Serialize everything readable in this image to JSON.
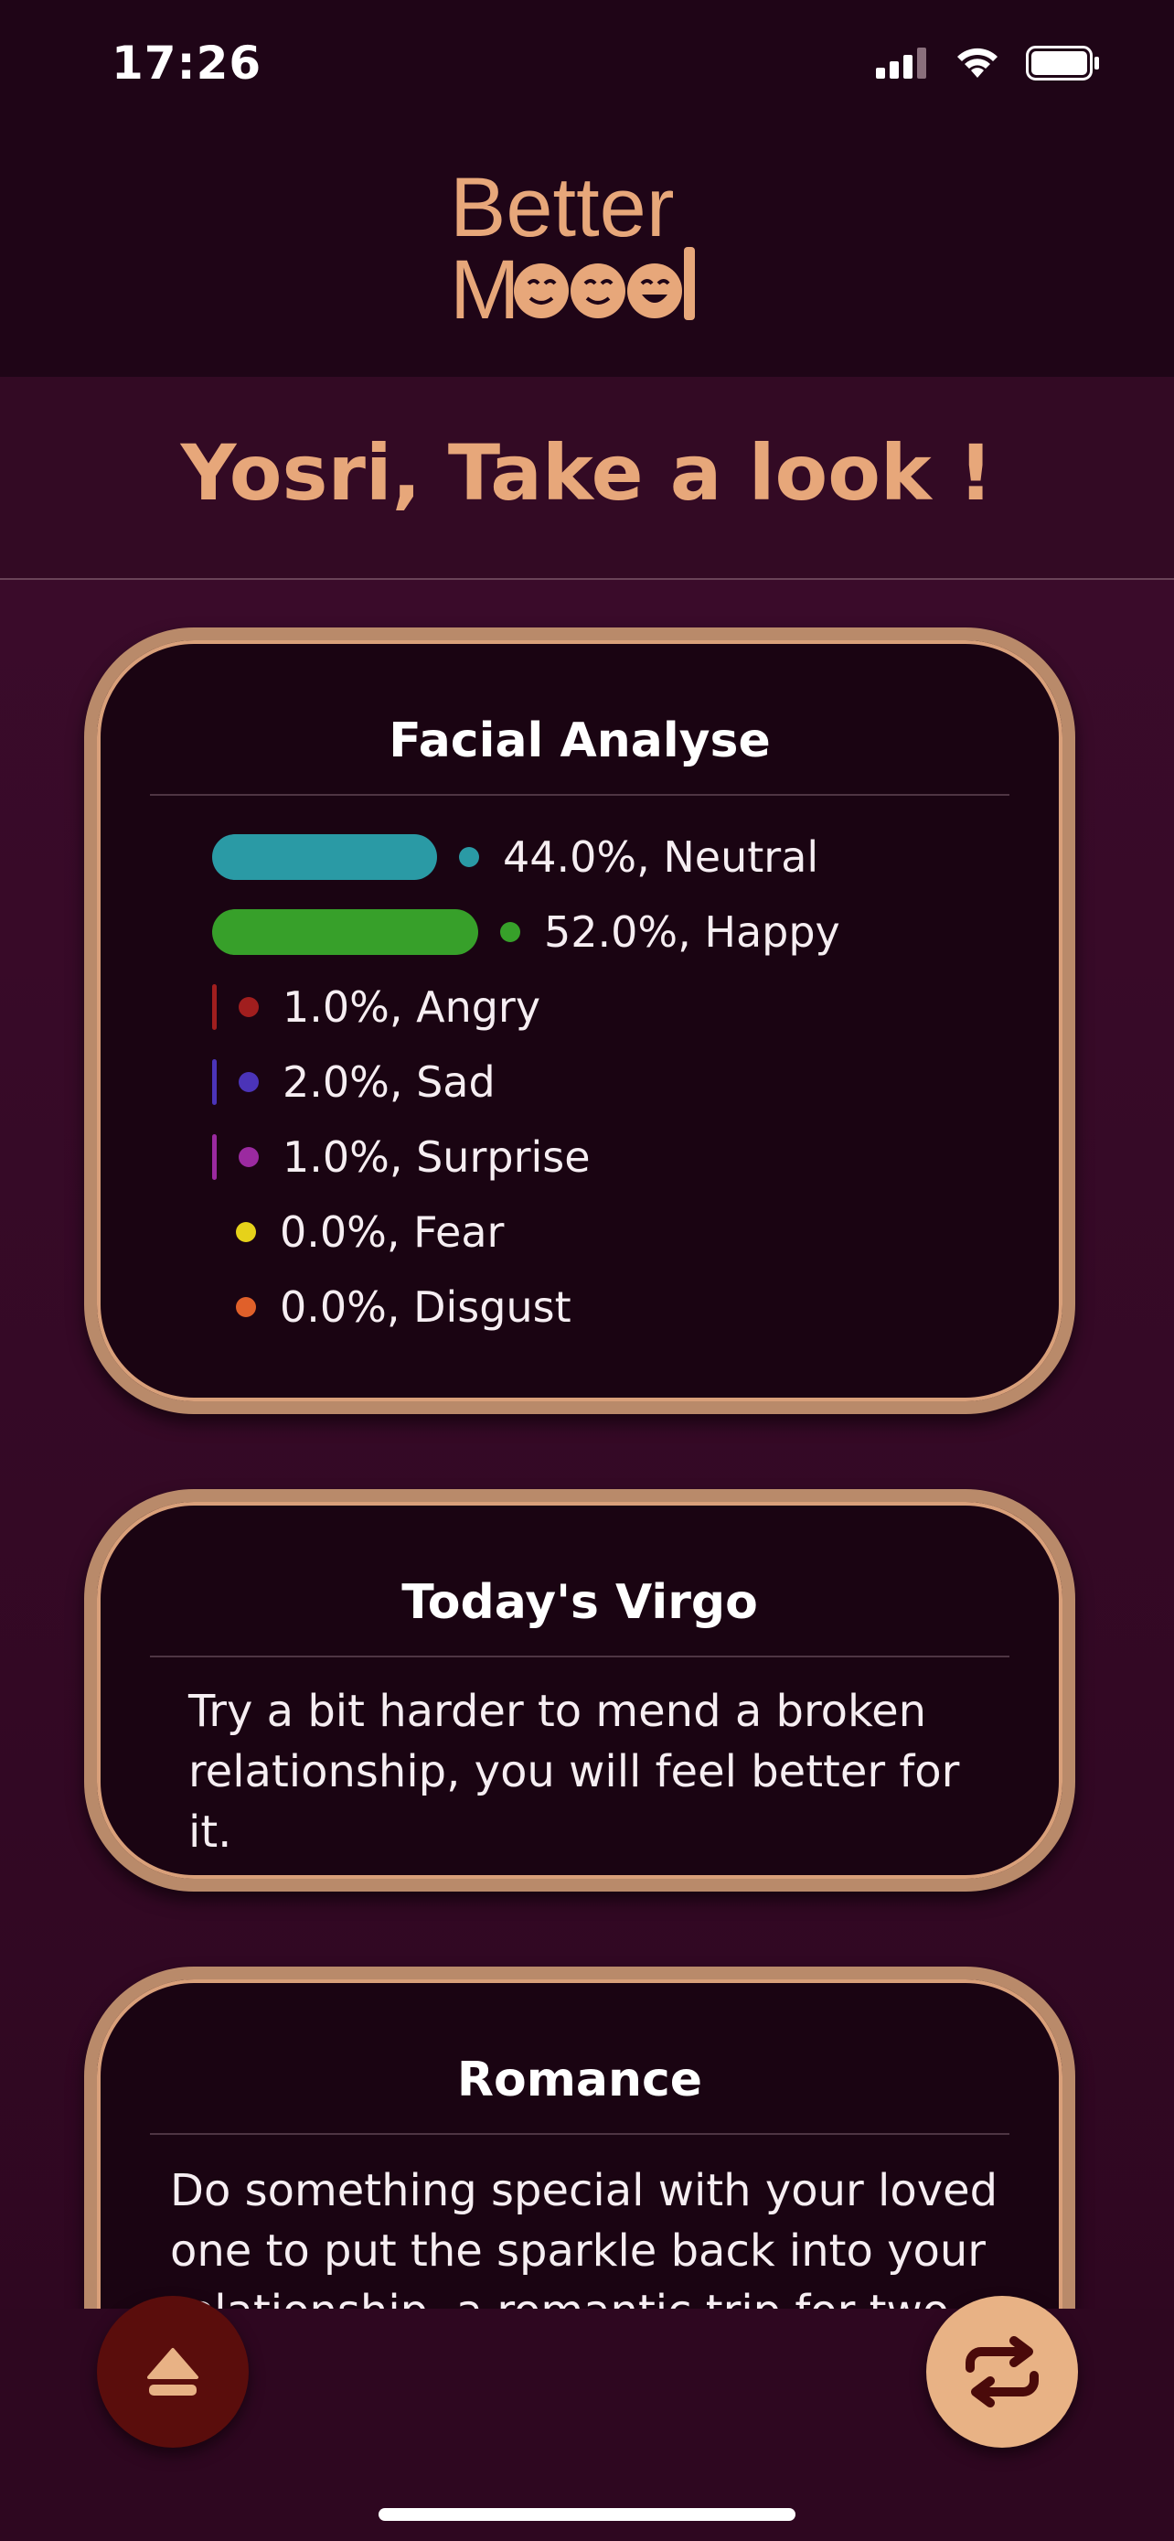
{
  "status_bar": {
    "time": "17:26"
  },
  "app": {
    "logo_line1": "Better",
    "logo_line2": "M",
    "logo_line2_end": "d"
  },
  "greeting": "Yosri, Take a look !",
  "facial_card": {
    "title": "Facial Analyse",
    "emotions": [
      {
        "label": "44.0%, Neutral",
        "percent": 44.0,
        "color": "#2a9aa5"
      },
      {
        "label": "52.0%, Happy",
        "percent": 52.0,
        "color": "#37a02a"
      },
      {
        "label": "1.0%, Angry",
        "percent": 1.0,
        "color": "#a11e1e"
      },
      {
        "label": "2.0%, Sad",
        "percent": 2.0,
        "color": "#4b34b8"
      },
      {
        "label": "1.0%, Surprise",
        "percent": 1.0,
        "color": "#9b2aa0"
      },
      {
        "label": "0.0%, Fear",
        "percent": 0.0,
        "color": "#e6d21a"
      },
      {
        "label": "0.0%, Disgust",
        "percent": 0.0,
        "color": "#e0602a"
      }
    ]
  },
  "horoscope_card": {
    "title": "Today's Virgo",
    "text": "Try a bit harder to mend a broken relationship, you will feel better for it."
  },
  "romance_card": {
    "title": "Romance",
    "text": "Do something special with your loved one to put the sparkle back into your relationship, a romantic trip for two or"
  },
  "buttons": {
    "left_icon": "eject-icon",
    "right_icon": "repeat-icon"
  },
  "colors": {
    "accent": "#e7a77a",
    "background": "#2e0720",
    "card": "#1a0412",
    "card_border": "#b98a6a"
  }
}
